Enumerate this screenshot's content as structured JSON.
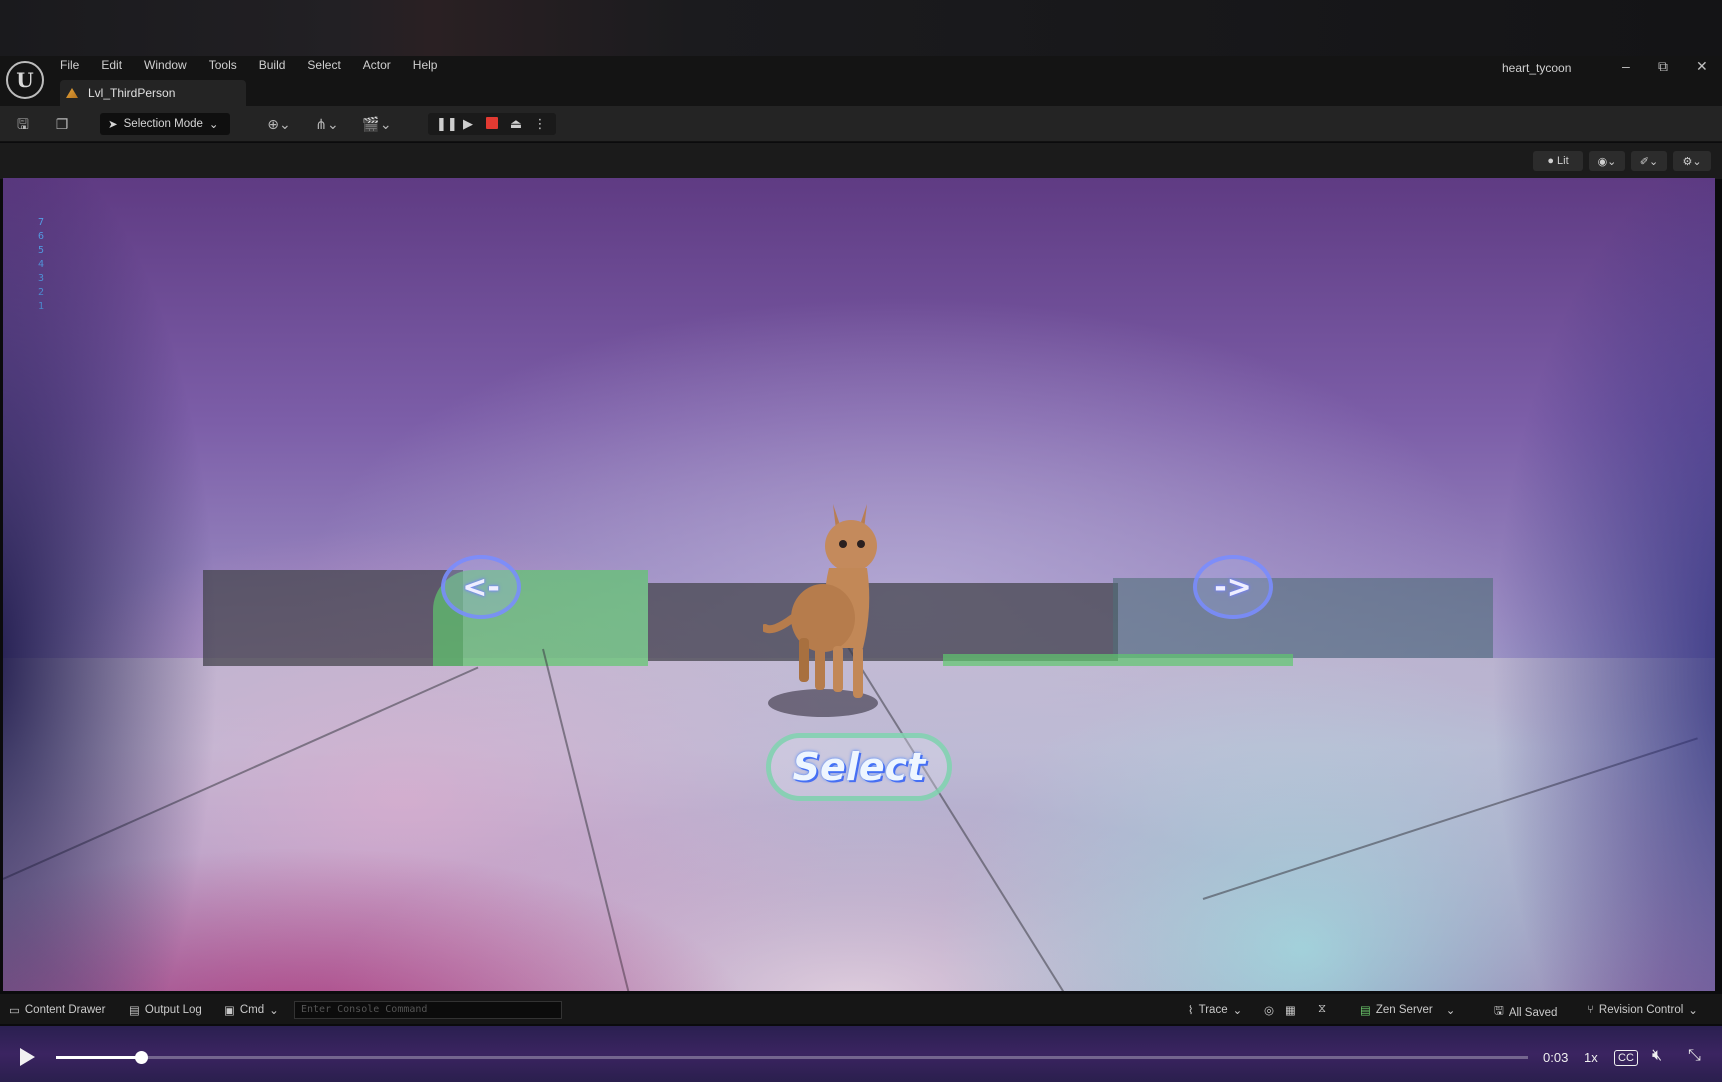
{
  "window": {
    "project_name": "heart_tycoon",
    "controls": [
      "–",
      "⧉",
      "✕"
    ]
  },
  "menu": [
    "File",
    "Edit",
    "Window",
    "Tools",
    "Build",
    "Select",
    "Actor",
    "Help"
  ],
  "tab": {
    "label": "Lvl_ThirdPerson"
  },
  "toolbar": {
    "selection_mode": "Selection Mode"
  },
  "viewport_bar": {
    "lit_label": "Lit"
  },
  "viewport": {
    "fps_numbers": [
      "7",
      "6",
      "5",
      "4",
      "3",
      "2",
      "1"
    ],
    "left_button": "<-",
    "right_button": "->",
    "select_button": "Select"
  },
  "statusbar": {
    "content_drawer": "Content Drawer",
    "output_log": "Output Log",
    "cmd": "Cmd",
    "console_placeholder": "Enter Console Command",
    "trace": "Trace",
    "zen_server": "Zen Server",
    "all_saved": "All Saved",
    "revision_control": "Revision Control"
  },
  "player": {
    "time": "0:03",
    "speed": "1x",
    "progress": 0.058,
    "cc_label": "CC"
  },
  "colors": {
    "stop_red": "#e23a32",
    "fps_blue": "#5fb4ff",
    "nav_ring": "#7f8cff",
    "select_ring": "#78d2aa"
  }
}
